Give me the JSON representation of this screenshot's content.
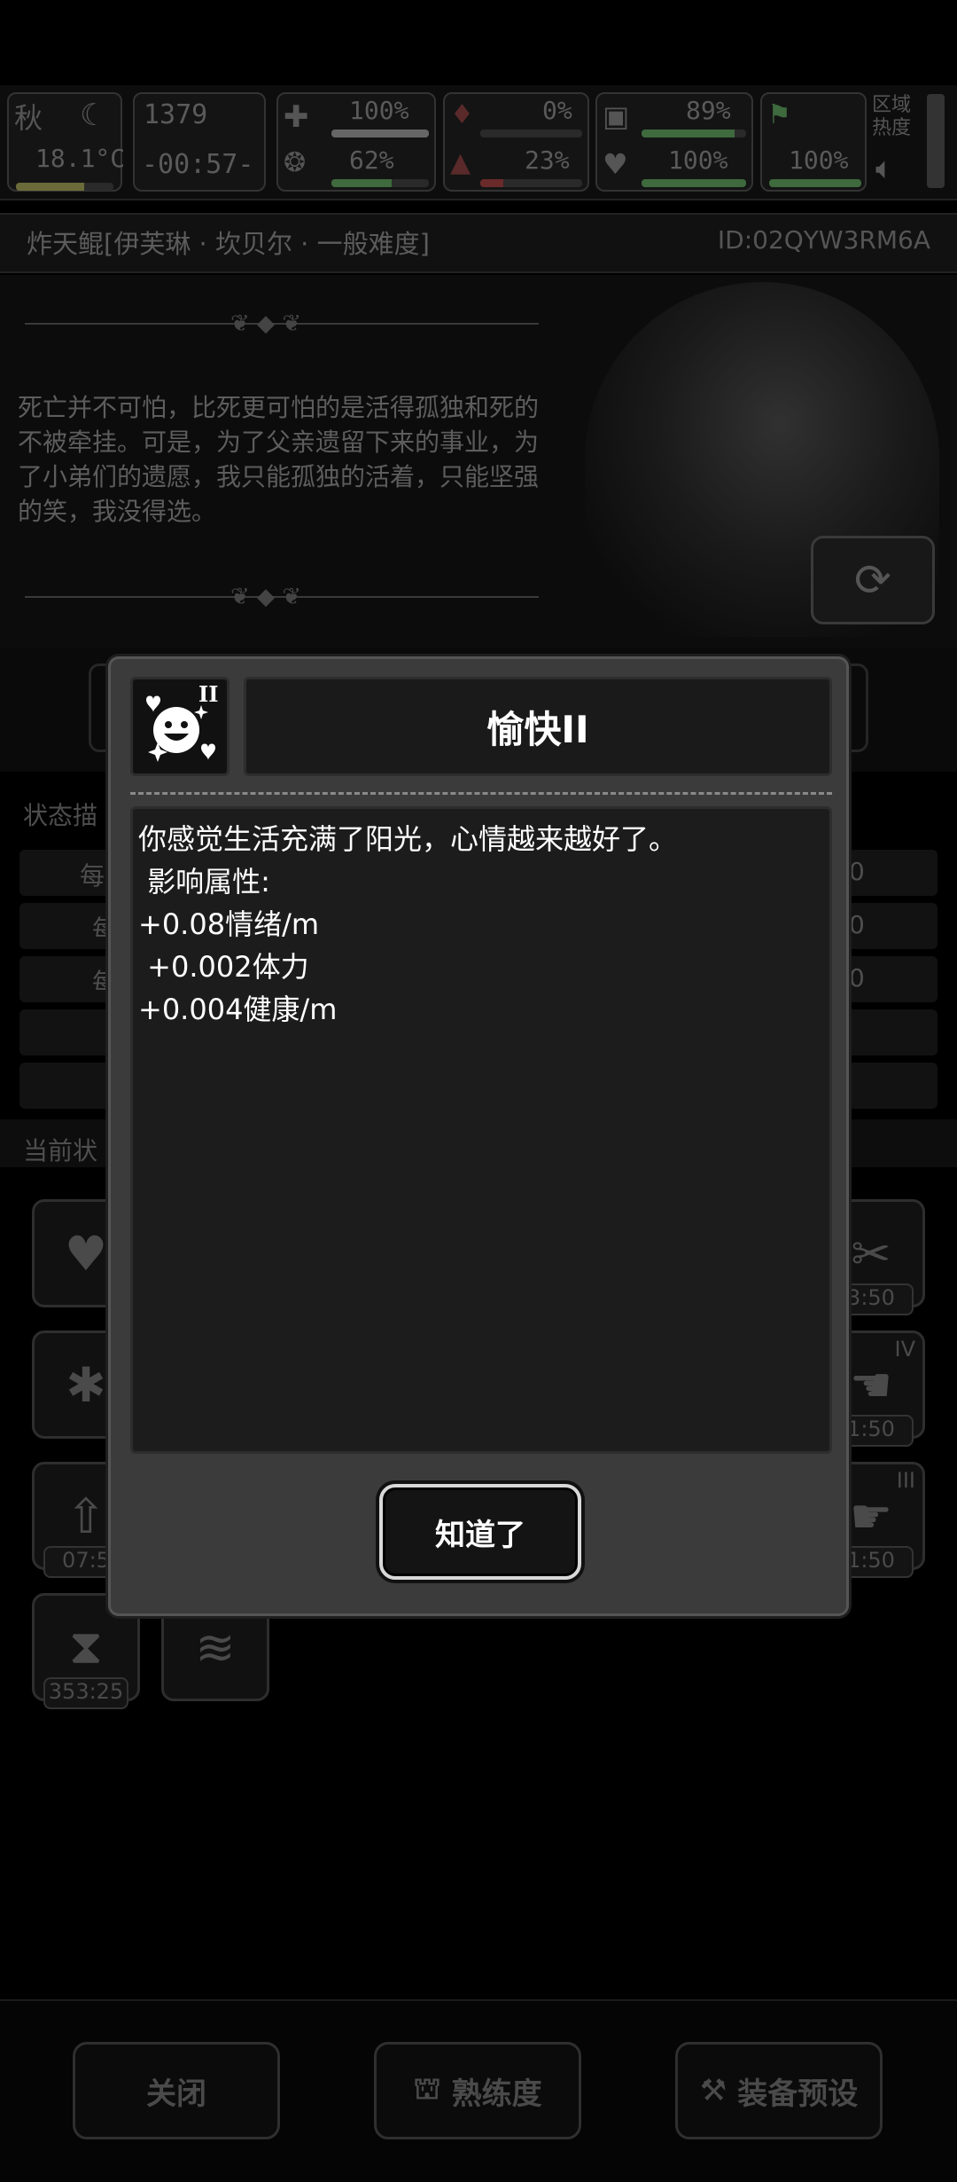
{
  "hud": {
    "season": "秋",
    "temperature": "18.1°C",
    "day": "1379",
    "clock": "-00:57-",
    "stat_a": "100%",
    "stat_b": "62%",
    "stat_c": "0%",
    "stat_d": "23%",
    "stat_e": "89%",
    "stat_f": "100%",
    "stat_g": "100%",
    "region_label": "区域热度"
  },
  "character": {
    "title": "炸天鲲[伊芙琳 · 坎贝尔 · 一般难度]",
    "id": "ID:02QYW3RM6A",
    "quote": "死亡并不可怕，比死更可怕的是活得孤独和死的不被牵挂。可是，为了父亲遗留下来的事业，为了小弟们的遗愿，我只能孤独的活着，只能坚强的笑，我没得选。"
  },
  "background": {
    "section1_label": "状态描",
    "section2_label": "当前状",
    "row_label_1": "每",
    "row_label_2": "每",
    "row_label_3": "每",
    "row_value": "0",
    "slot_times": [
      "07:5",
      "353:25",
      "3:50",
      "1:50",
      "1:50"
    ],
    "roman_4": "IV",
    "roman_3": "III"
  },
  "bottom_bar": {
    "close": "关闭",
    "proficiency": "熟练度",
    "equipment_preset": "装备预设"
  },
  "dialog": {
    "icon_level": "II",
    "title": "愉快II",
    "lines": [
      "你感觉生活充满了阳光，心情越来越好了。",
      " 影响属性:",
      "+0.08情绪/m",
      " +0.002体力",
      "+0.004健康/m"
    ],
    "ok_label": "知道了"
  },
  "colors": {
    "dialog_bg": "#3b3b3b",
    "dialog_text": "#ffffff",
    "overlay": "#000000"
  }
}
